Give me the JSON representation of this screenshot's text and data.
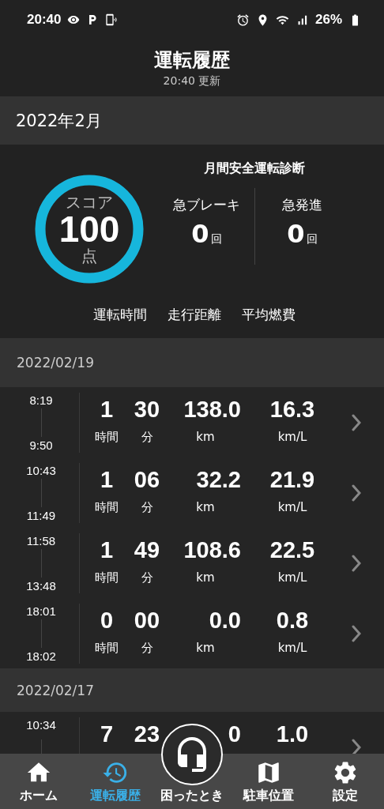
{
  "status_bar": {
    "time": "20:40",
    "battery": "26%"
  },
  "header": {
    "title": "運転履歴",
    "updated": "20:40 更新"
  },
  "month": "2022年2月",
  "summary": {
    "title": "月間安全運転診断",
    "score_label": "スコア",
    "score": "100",
    "score_unit": "点",
    "level": 1,
    "counters": [
      {
        "label": "急ブレーキ",
        "value": "0",
        "unit": "回"
      },
      {
        "label": "急発進",
        "value": "0",
        "unit": "回"
      }
    ],
    "columns": [
      "運転時間",
      "走行距離",
      "平均燃費"
    ]
  },
  "days": [
    {
      "date": "2022/02/19",
      "trips": [
        {
          "start": "8:19",
          "end": "9:50",
          "hours": "1",
          "hours_unit": "時間",
          "minutes": "30",
          "minutes_unit": "分",
          "distance": "138.0",
          "distance_unit": "km",
          "economy": "16.3",
          "economy_unit": "km/L"
        },
        {
          "start": "10:43",
          "end": "11:49",
          "hours": "1",
          "hours_unit": "時間",
          "minutes": "06",
          "minutes_unit": "分",
          "distance": "32.2",
          "distance_unit": "km",
          "economy": "21.9",
          "economy_unit": "km/L"
        },
        {
          "start": "11:58",
          "end": "13:48",
          "hours": "1",
          "hours_unit": "時間",
          "minutes": "49",
          "minutes_unit": "分",
          "distance": "108.6",
          "distance_unit": "km",
          "economy": "22.5",
          "economy_unit": "km/L"
        },
        {
          "start": "18:01",
          "end": "18:02",
          "hours": "0",
          "hours_unit": "時間",
          "minutes": "00",
          "minutes_unit": "分",
          "distance": "0.0",
          "distance_unit": "km",
          "economy": "0.8",
          "economy_unit": "km/L"
        }
      ]
    },
    {
      "date": "2022/02/17",
      "trips": [
        {
          "start": "10:34",
          "hours": "7",
          "minutes": "23",
          "distance": "0",
          "economy": "1.0"
        }
      ]
    }
  ],
  "nav": [
    {
      "label": "ホーム",
      "selected": false
    },
    {
      "label": "運転履歴",
      "selected": true
    },
    {
      "label": "困ったとき",
      "selected": false
    },
    {
      "label": "駐車位置",
      "selected": false
    },
    {
      "label": "設定",
      "selected": false
    }
  ]
}
